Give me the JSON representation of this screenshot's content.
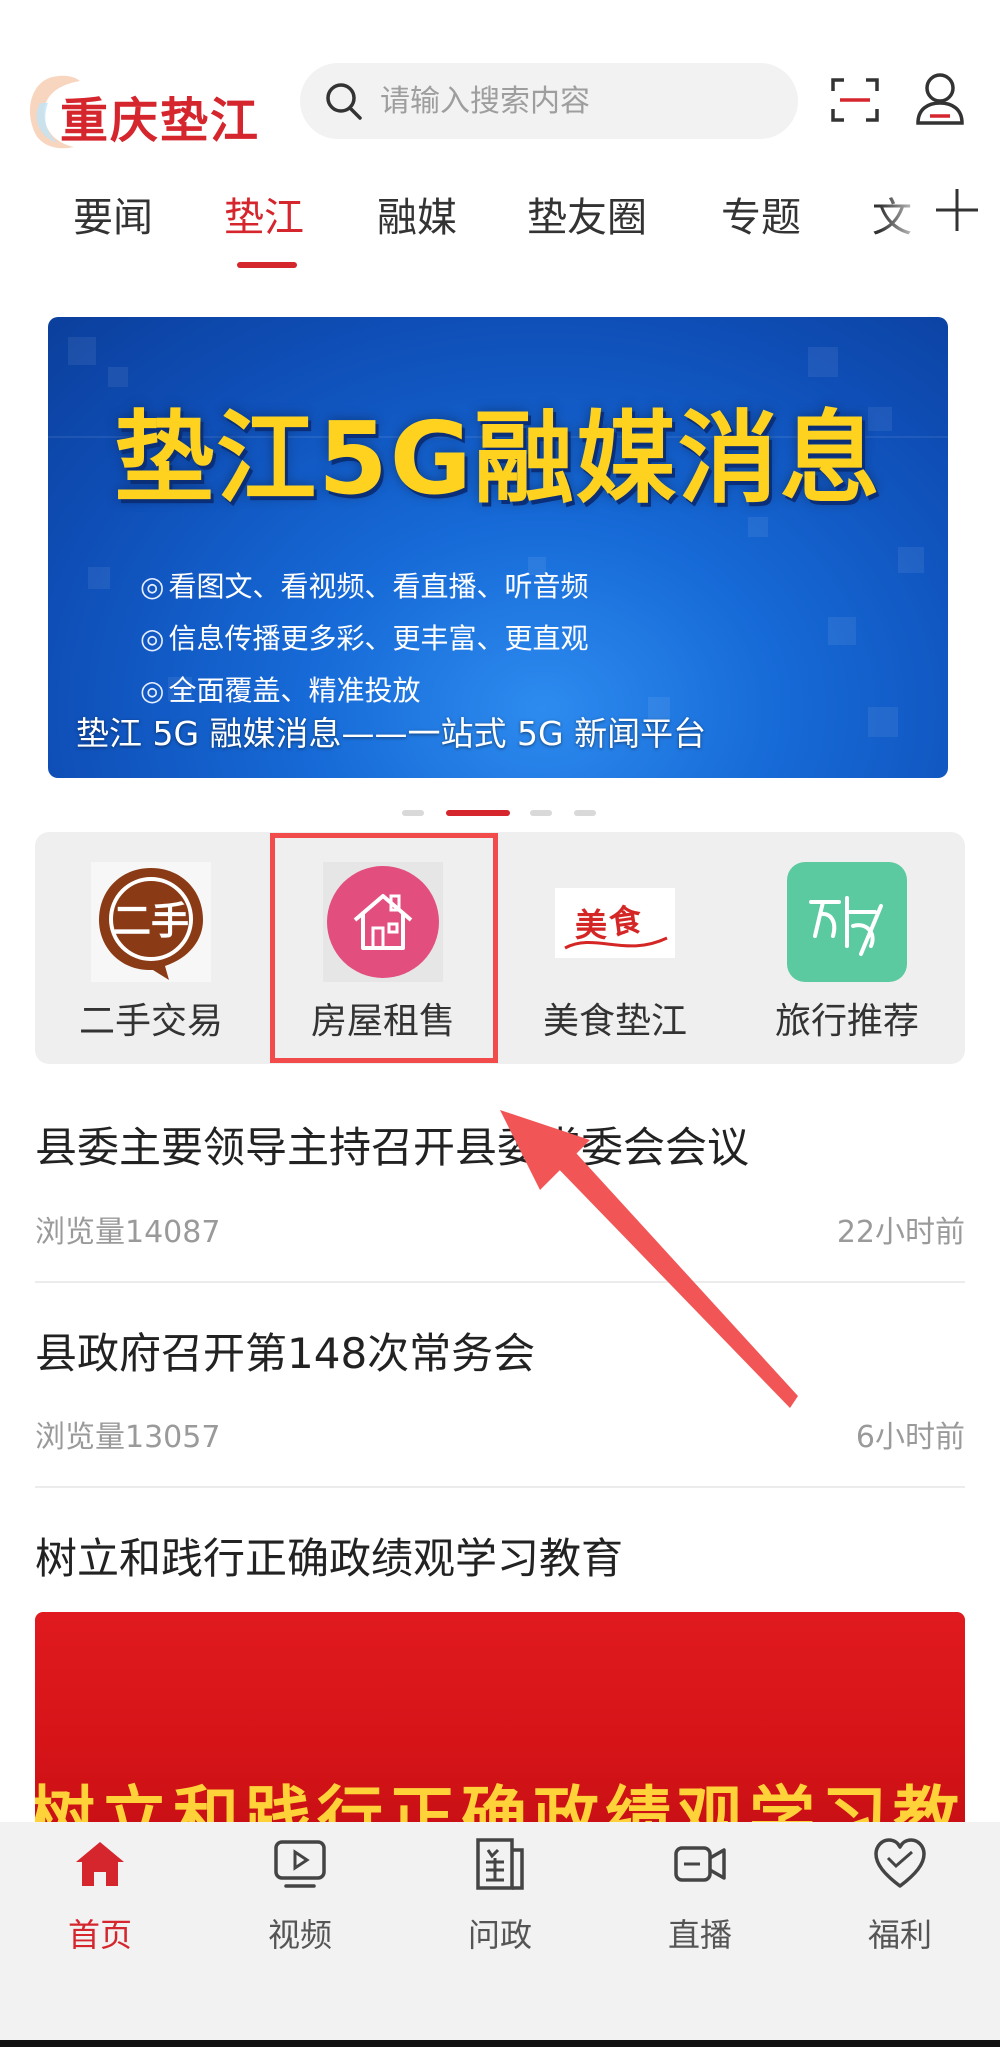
{
  "header": {
    "logo_text": "重庆垫江",
    "search_placeholder": "请输入搜索内容"
  },
  "tabs": [
    {
      "label": "要闻",
      "active": false
    },
    {
      "label": "垫江",
      "active": true
    },
    {
      "label": "融媒",
      "active": false
    },
    {
      "label": "垫友圈",
      "active": false
    },
    {
      "label": "专题",
      "active": false
    },
    {
      "label": "文",
      "active": false
    }
  ],
  "banner": {
    "title": "垫江5G融媒消息",
    "lines": [
      "看图文、看视频、看直播、听音频",
      "信息传播更多彩、更丰富、更直观",
      "全面覆盖、精准投放"
    ],
    "caption": "垫江 5G 融媒消息——一站式 5G 新闻平台",
    "slide_count": 4,
    "active_slide": 2
  },
  "services": [
    {
      "label": "二手交易",
      "icon": "secondhand-icon"
    },
    {
      "label": "房屋租售",
      "icon": "house-icon"
    },
    {
      "label": "美食垫江",
      "icon": "food-icon"
    },
    {
      "label": "旅行推荐",
      "icon": "travel-icon"
    }
  ],
  "news": [
    {
      "title": "县委主要领导主持召开县委常委会会议",
      "views": "浏览量14087",
      "time": "22小时前"
    },
    {
      "title": "县政府召开第148次常务会",
      "views": "浏览量13057",
      "time": "6小时前"
    },
    {
      "title": "树立和践行正确政绩观学习教育",
      "image_text": "树立和践行正确政绩观学习教育"
    }
  ],
  "bottom_nav": [
    {
      "label": "首页",
      "icon": "home-icon",
      "active": true
    },
    {
      "label": "视频",
      "icon": "video-icon",
      "active": false
    },
    {
      "label": "问政",
      "icon": "inquiry-icon",
      "active": false
    },
    {
      "label": "直播",
      "icon": "live-icon",
      "active": false
    },
    {
      "label": "福利",
      "icon": "heart-icon",
      "active": false
    }
  ],
  "colors": {
    "brand_red": "#d5252d",
    "highlight": "#f14b4b",
    "banner_blue": "#1669d6",
    "banner_title": "#ffd21f"
  }
}
